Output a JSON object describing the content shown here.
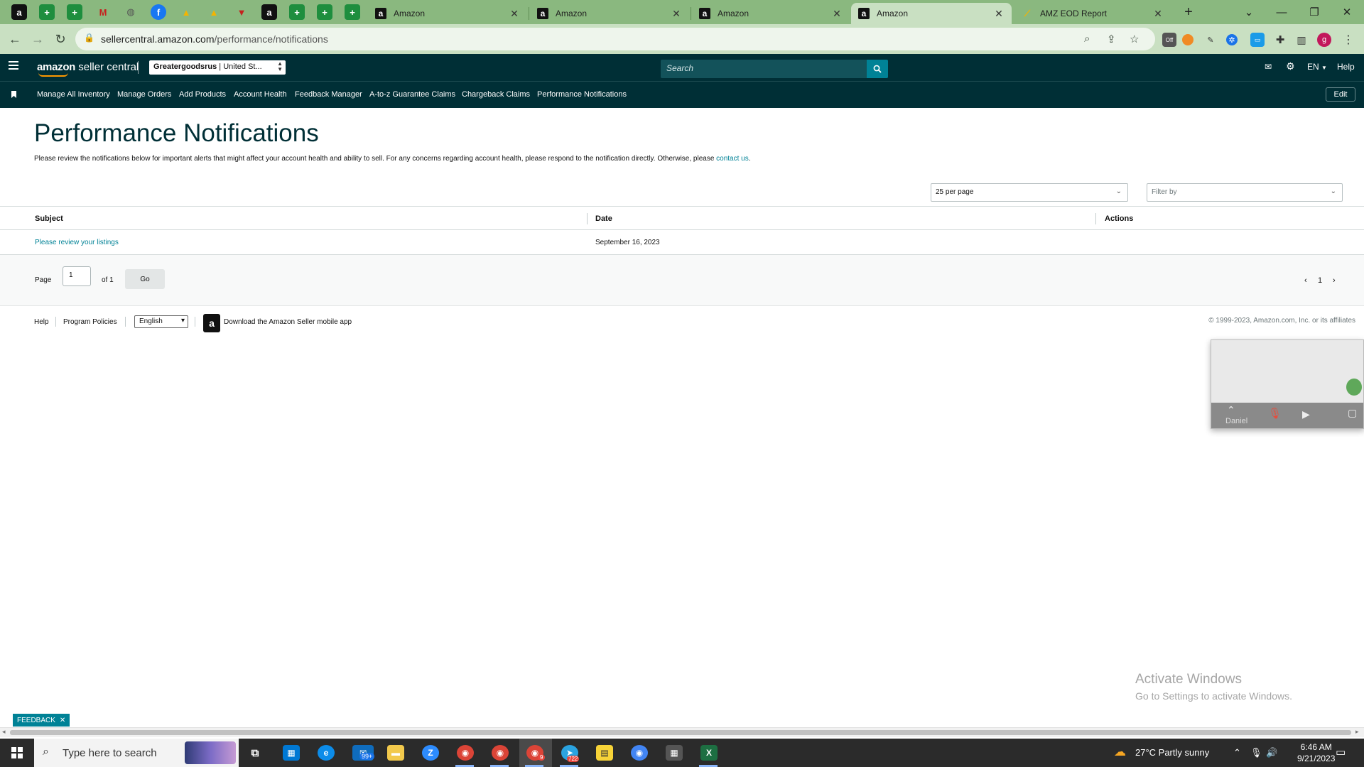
{
  "browser": {
    "tabs": [
      {
        "title": "Amazon"
      },
      {
        "title": "Amazon"
      },
      {
        "title": "Amazon"
      },
      {
        "title": "Amazon"
      },
      {
        "title": "AMZ EOD Report"
      }
    ],
    "url_host": "sellercentral.amazon.com",
    "url_path": "/performance/notifications",
    "profile_initial": "g"
  },
  "header": {
    "logo_amazon": "amazon",
    "logo_product": "seller central",
    "store_name": "Greatergoodsrus",
    "store_region": " | United St...",
    "search_placeholder": "Search",
    "lang": "EN",
    "help": "Help"
  },
  "nav": {
    "items": [
      "Manage All Inventory",
      "Manage Orders",
      "Add Products",
      "Account Health",
      "Feedback Manager",
      "A-to-z Guarantee Claims",
      "Chargeback Claims",
      "Performance Notifications"
    ],
    "edit": "Edit"
  },
  "page": {
    "title": "Performance Notifications",
    "intro": "Please review the notifications below for important alerts that might affect your account health and ability to sell. For any concerns regarding account health, please respond to the notification directly. Otherwise, please ",
    "intro_link": "contact us",
    "intro_end": ".",
    "per_page": "25 per page",
    "filter_placeholder": "Filter by"
  },
  "table": {
    "columns": [
      "Subject",
      "Date",
      "Actions"
    ],
    "rows": [
      {
        "subject": "Please review your listings",
        "date": "September 16, 2023"
      }
    ]
  },
  "pager": {
    "page_label": "Page",
    "page_value": "1",
    "of_label": "of 1",
    "go": "Go",
    "current": "1"
  },
  "footer": {
    "help": "Help",
    "policies": "Program Policies",
    "language": "English",
    "app": "Download the Amazon Seller mobile app",
    "copyright": "© 1999-2023, Amazon.com, Inc. or its affiliates"
  },
  "video": {
    "name": "Daniel"
  },
  "watermark": {
    "line1": "Activate Windows",
    "line2": "Go to Settings to activate Windows."
  },
  "feedback": "FEEDBACK",
  "taskbar": {
    "search_placeholder": "Type here to search",
    "mail_badge": "99+",
    "chrome_badge": "9",
    "telegram_badge": "722",
    "weather": "27°C  Partly sunny",
    "time": "6:46 AM",
    "date": "9/21/2023"
  },
  "colors": {
    "tabstrip": "#8ab87f",
    "header": "#002f36",
    "accent": "#008296",
    "title": "#002f36"
  }
}
